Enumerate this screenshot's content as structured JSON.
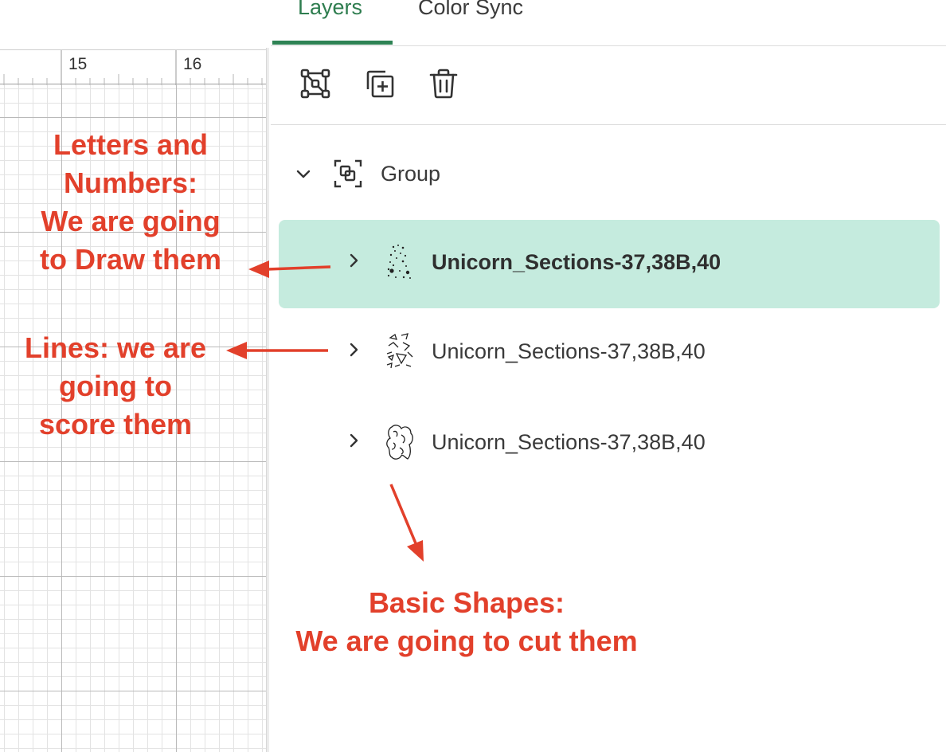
{
  "ruler": {
    "labels": [
      "15",
      "16"
    ]
  },
  "tabs": [
    {
      "label": "Layers",
      "active": true
    },
    {
      "label": "Color Sync",
      "active": false
    }
  ],
  "toolbar": {
    "icons": [
      "group-icon",
      "duplicate-icon",
      "delete-icon"
    ]
  },
  "group": {
    "label": "Group",
    "expanded": true
  },
  "layers": [
    {
      "label": "Unicorn_Sections-37,38B,40",
      "selected": true,
      "thumb": "dots-thumbnail"
    },
    {
      "label": "Unicorn_Sections-37,38B,40",
      "selected": false,
      "thumb": "lines-thumbnail"
    },
    {
      "label": "Unicorn_Sections-37,38B,40",
      "selected": false,
      "thumb": "shapes-thumbnail"
    }
  ],
  "annotations": {
    "draw": [
      "Letters and",
      "Numbers:",
      "We are going",
      "to Draw them"
    ],
    "score": [
      "Lines: we are",
      "going to",
      "score them"
    ],
    "cut": [
      "Basic Shapes:",
      "We are going to cut them"
    ]
  },
  "colors": {
    "accent": "#2e8354",
    "selected_bg": "#c5ebde",
    "annotation": "#e2402b"
  }
}
